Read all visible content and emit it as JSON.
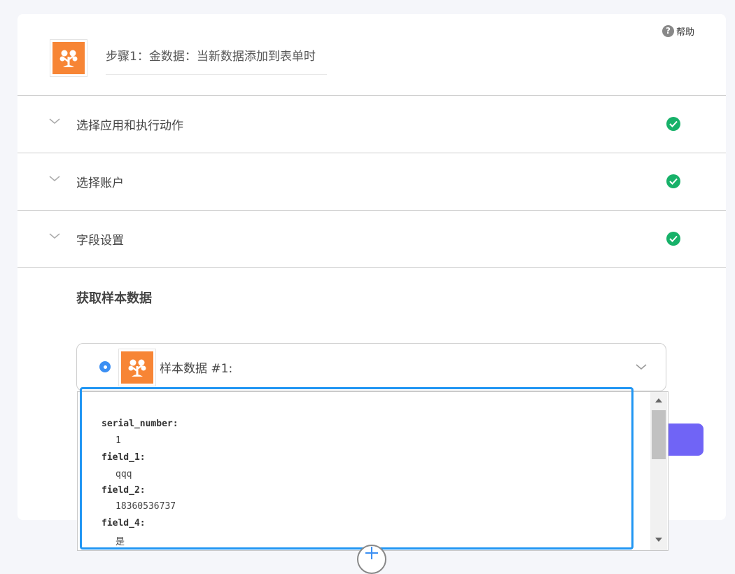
{
  "help": {
    "label": "帮助"
  },
  "step": {
    "title": "步骤1：金数据：当新数据添加到表单时"
  },
  "sections": [
    {
      "label": "选择应用和执行动作",
      "status": "complete"
    },
    {
      "label": "选择账户",
      "status": "complete"
    },
    {
      "label": "字段设置",
      "status": "complete"
    }
  ],
  "sample": {
    "heading": "获取样本数据",
    "selected_label": "样本数据 #1:",
    "fields": [
      {
        "key": "serial_number:",
        "value": "1"
      },
      {
        "key": "field_1:",
        "value": "qqq"
      },
      {
        "key": "field_2:",
        "value": "18360536737"
      },
      {
        "key": "field_4:",
        "value": "是"
      }
    ]
  },
  "colors": {
    "accent": "#3b8ff3",
    "success": "#17b169",
    "brand": "#f78535",
    "highlight": "#2196f3",
    "primary_button": "#7064f6"
  },
  "icons": {
    "help": "question-circle-icon",
    "app": "jinshuju-tree-icon",
    "collapse": "chevron-down-icon",
    "status": "check-circle-icon",
    "add": "plus-icon"
  }
}
